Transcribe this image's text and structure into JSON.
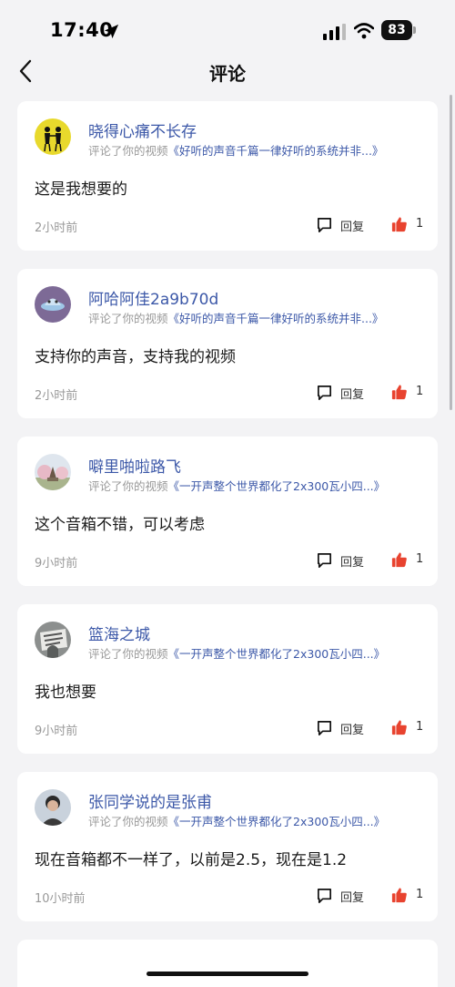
{
  "status_bar": {
    "time": "17:40",
    "battery": "83"
  },
  "nav": {
    "title": "评论"
  },
  "comments": [
    {
      "name": "晓得心痛不长存",
      "action": "评论了你的视频",
      "video": "《好听的声音千篇一律好听的系统并非...》",
      "text": "这是我想要的",
      "time": "2小时前",
      "reply": "回复",
      "likes": "1"
    },
    {
      "name": "阿哈阿佳2a9b70d",
      "action": "评论了你的视频",
      "video": "《好听的声音千篇一律好听的系统并非...》",
      "text": "支持你的声音，支持我的视频",
      "time": "2小时前",
      "reply": "回复",
      "likes": "1"
    },
    {
      "name": "噼里啪啦路飞",
      "action": "评论了你的视频",
      "video": "《一开声整个世界都化了2x300瓦小四...》",
      "text": "这个音箱不错，可以考虑",
      "time": "9小时前",
      "reply": "回复",
      "likes": "1"
    },
    {
      "name": "篮海之城",
      "action": "评论了你的视频",
      "video": "《一开声整个世界都化了2x300瓦小四...》",
      "text": "我也想要",
      "time": "9小时前",
      "reply": "回复",
      "likes": "1"
    },
    {
      "name": "张同学说的是张甫",
      "action": "评论了你的视频",
      "video": "《一开声整个世界都化了2x300瓦小四...》",
      "text": "现在音箱都不一样了，以前是2.5，现在是1.2",
      "time": "10小时前",
      "reply": "回复",
      "likes": "1"
    }
  ],
  "colors": {
    "link": "#3c58a8",
    "like": "#e8432f",
    "background": "#f3f3f5"
  },
  "icons": [
    "location-arrow-icon",
    "signal-icon",
    "wifi-icon",
    "battery-icon",
    "back-icon",
    "reply-icon",
    "thumbs-up-icon"
  ]
}
